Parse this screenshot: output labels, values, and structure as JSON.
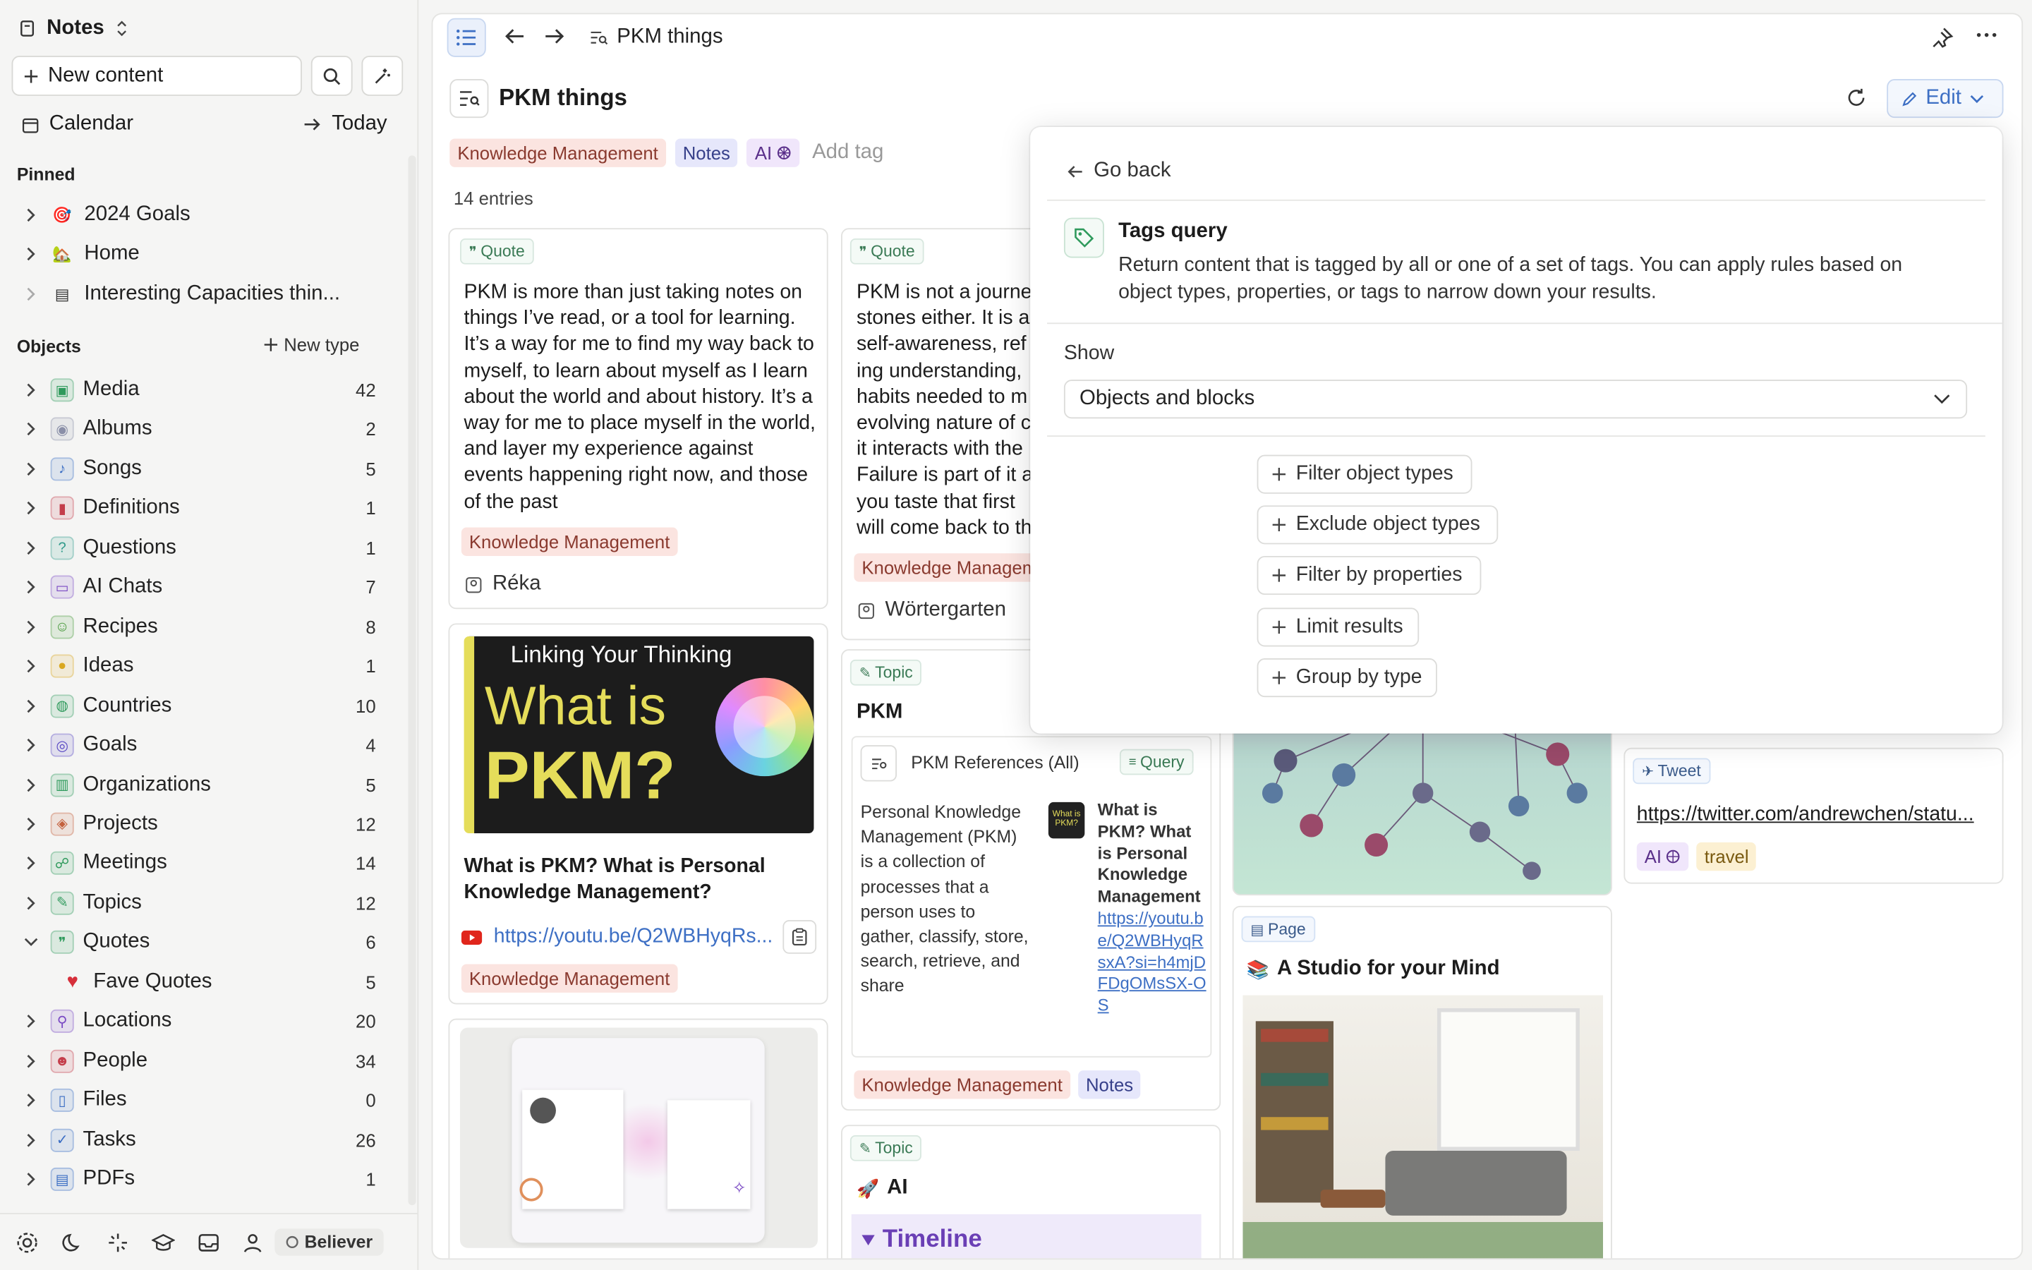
{
  "sidebar": {
    "workspace": "Notes",
    "new_content": "New content",
    "calendar": "Calendar",
    "today": "Today",
    "pinned_title": "Pinned",
    "pinned": [
      {
        "label": "2024 Goals",
        "icon": "target-icon"
      },
      {
        "label": "Home",
        "icon": "house-icon"
      },
      {
        "label": "Interesting Capacities thin...",
        "icon": "page-icon"
      }
    ],
    "objects_title": "Objects",
    "new_type": "New type",
    "objects": [
      {
        "label": "Media",
        "count": "42",
        "icon": "media-icon",
        "color": "#2f9a5c"
      },
      {
        "label": "Albums",
        "count": "2",
        "icon": "album-icon",
        "color": "#8a8fa8"
      },
      {
        "label": "Songs",
        "count": "5",
        "icon": "music-icon",
        "color": "#3d6fc4"
      },
      {
        "label": "Definitions",
        "count": "1",
        "icon": "book-icon",
        "color": "#c43d4a"
      },
      {
        "label": "Questions",
        "count": "1",
        "icon": "question-icon",
        "color": "#2f9a8a"
      },
      {
        "label": "AI Chats",
        "count": "7",
        "icon": "chat-icon",
        "color": "#7a4ac4"
      },
      {
        "label": "Recipes",
        "count": "8",
        "icon": "recipe-icon",
        "color": "#4a9a3d"
      },
      {
        "label": "Ideas",
        "count": "1",
        "icon": "bulb-icon",
        "color": "#d9a820"
      },
      {
        "label": "Countries",
        "count": "10",
        "icon": "globe-icon",
        "color": "#2f9a5c"
      },
      {
        "label": "Goals",
        "count": "4",
        "icon": "goal-icon",
        "color": "#5a4ac4"
      },
      {
        "label": "Organizations",
        "count": "5",
        "icon": "building-icon",
        "color": "#2f9a5c"
      },
      {
        "label": "Projects",
        "count": "12",
        "icon": "cube-icon",
        "color": "#c4613d"
      },
      {
        "label": "Meetings",
        "count": "14",
        "icon": "meeting-icon",
        "color": "#2f9a5c"
      },
      {
        "label": "Topics",
        "count": "12",
        "icon": "topic-icon",
        "color": "#2f9a5c"
      },
      {
        "label": "Quotes",
        "count": "6",
        "icon": "quote-icon",
        "color": "#2f9a5c",
        "expanded": true
      },
      {
        "label": "Fave Quotes",
        "count": "5",
        "icon": "heart-icon",
        "color": "#d62f3a",
        "child": true
      },
      {
        "label": "Locations",
        "count": "20",
        "icon": "pin-icon",
        "color": "#7a4ac4"
      },
      {
        "label": "People",
        "count": "34",
        "icon": "person-icon",
        "color": "#c43d4a"
      },
      {
        "label": "Files",
        "count": "0",
        "icon": "file-icon",
        "color": "#3d6fc4"
      },
      {
        "label": "Tasks",
        "count": "26",
        "icon": "check-icon",
        "color": "#3d6fc4"
      },
      {
        "label": "PDFs",
        "count": "1",
        "icon": "pdf-icon",
        "color": "#3d6fc4"
      }
    ],
    "footer_badge": "Believer"
  },
  "topbar": {
    "title": "PKM things"
  },
  "header": {
    "title": "PKM things",
    "edit": "Edit"
  },
  "tags": [
    "Knowledge Management",
    "Notes",
    "AI"
  ],
  "add_tag": "Add tag",
  "entries": "14 entries",
  "cards": {
    "quote1": {
      "type": "Quote",
      "text": "PKM is more than just taking notes on things I’ve read, or a tool for learning. It’s a way for me to find my way back to myself, to learn about myself as I learn about the world and about history. It’s a way for me to place myself in the world, and layer my experience against events happening right now, and those of the past",
      "tag": "Knowledge Management",
      "author": "Réka"
    },
    "quote2": {
      "type": "Quote",
      "lines": [
        "PKM is not a journe",
        "stones either. It is a",
        "self-awareness, ref",
        "ing understanding, ",
        "habits needed to m",
        "evolving nature of c",
        "it interacts with the",
        "Failure is part of it a",
        "you taste that first ",
        "will come back to th"
      ],
      "tag": "Knowledge Managem",
      "author": "Wörtergarten"
    },
    "video": {
      "thumb_brand": "Linking Your Thinking",
      "thumb_line1": "What is",
      "thumb_line2": "PKM?",
      "title": "What is PKM? What is Personal Knowledge Management?",
      "url": "https://youtu.be/Q2WBHyqRs...",
      "tag": "Knowledge Management"
    },
    "topic_pkm": {
      "type": "Topic",
      "title": "PKM",
      "query_title": "PKM References (All)",
      "query_chip": "Query",
      "desc": "Personal Knowledge Management (PKM) is a collection of processes that a person uses to gather, classify, store, search, retrieve, and share",
      "side_title": "What is PKM? What is Personal Knowledge Management",
      "side_link": "https://youtu.be/Q2WBHyqRsxA?si=h4mjDFDgOMsSX-OS",
      "thumb_text": "What is PKM?",
      "tags": [
        "Knowledge Management",
        "Notes"
      ]
    },
    "topic_ai": {
      "type": "Topic",
      "title": "AI",
      "timeline": "Timeline"
    },
    "page": {
      "type": "Page",
      "title": "A Studio for your Mind"
    },
    "tweet": {
      "type": "Tweet",
      "url": "https://twitter.com/andrewchen/statu...",
      "tags": [
        "AI",
        "travel"
      ]
    }
  },
  "popup": {
    "back": "Go back",
    "title": "Tags query",
    "desc": "Return content that is tagged by all or one of a set of tags. You can apply rules based on object types, properties, or tags to narrow down your results.",
    "show_label": "Show",
    "show_value": "Objects and blocks",
    "buttons": [
      "Filter object types",
      "Exclude object types",
      "Filter by properties",
      "Limit results",
      "Group by type"
    ]
  },
  "colors": {
    "accent": "#3d6fc4",
    "km_tag": "#fbe4e0",
    "notes_tag": "#e6e7fb",
    "ai_tag": "#f0e6fb",
    "travel_tag": "#fcf0d2"
  }
}
